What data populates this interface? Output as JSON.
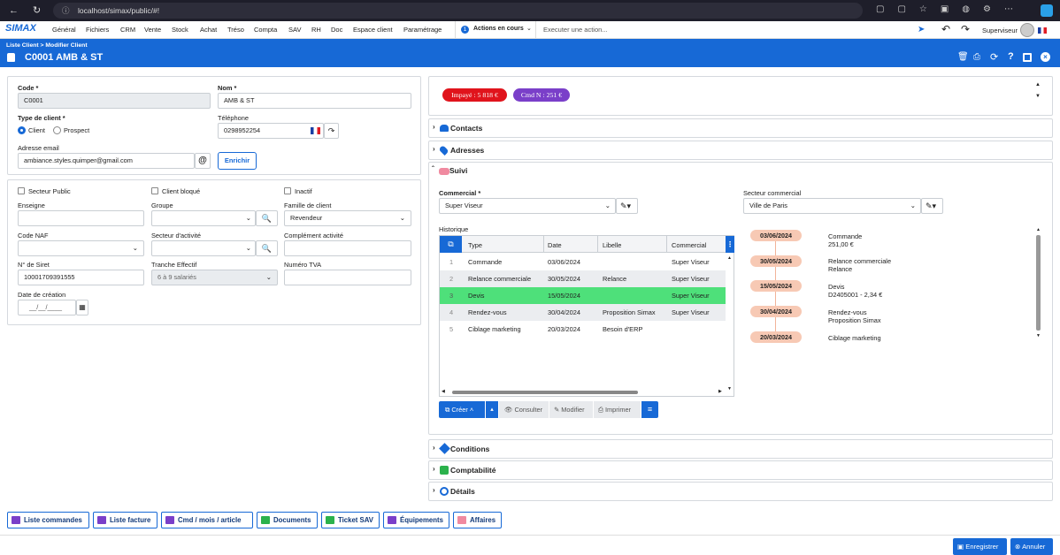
{
  "browser": {
    "url": "localhost/simax/public/#!"
  },
  "menu": {
    "logo": "SIMAX",
    "items": [
      "Général",
      "Fichiers",
      "CRM",
      "Vente",
      "Stock",
      "Achat",
      "Tréso",
      "Compta",
      "SAV",
      "RH",
      "Doc",
      "Espace client",
      "Paramétrage"
    ],
    "actions_count": "1",
    "actions_label": "Actions en cours",
    "execute_placeholder": "Executer une action...",
    "user": "Superviseur"
  },
  "header": {
    "breadcrumb": "Liste Client > Modifier Client",
    "title": "C0001 AMB & ST"
  },
  "form": {
    "code_label": "Code *",
    "code_value": "C0001",
    "nom_label": "Nom *",
    "nom_value": "AMB & ST",
    "type_label": "Type de client *",
    "type_client": "Client",
    "type_prospect": "Prospect",
    "tel_label": "Téléphone",
    "tel_value": "0298952254",
    "email_label": "Adresse email",
    "email_value": "ambiance.styles.quimper@gmail.com",
    "enrichir": "Enrichir",
    "secteur_public": "Secteur Public",
    "client_bloque": "Client bloqué",
    "inactif": "Inactif",
    "enseigne_label": "Enseigne",
    "groupe_label": "Groupe",
    "famille_label": "Famille de client",
    "famille_value": "Revendeur",
    "naf_label": "Code NAF",
    "secteur_label": "Secteur d'activité",
    "complement_label": "Complément activité",
    "siret_label": "N° de Siret",
    "siret_value": "10001709391555",
    "tranche_label": "Tranche Effectif",
    "tranche_value": "6 à 9 salariés",
    "tva_label": "Numéro TVA",
    "creation_label": "Date de création",
    "creation_value": "__/__/____"
  },
  "badges": {
    "impaye": "Impayé : 5 818 €",
    "cmd": "Cmd N : 251 €"
  },
  "sections": {
    "contacts": "Contacts",
    "adresses": "Adresses",
    "suivi": "Suivi",
    "conditions": "Conditions",
    "comptabilite": "Comptabilité",
    "details": "Détails"
  },
  "suivi": {
    "commercial_label": "Commercial *",
    "commercial_value": "Super Viseur",
    "secteur_label": "Secteur commercial",
    "secteur_value": "Ville de Paris",
    "historique_label": "Historique",
    "columns": [
      "Type",
      "Date",
      "Libelle",
      "Commercial"
    ],
    "rows": [
      {
        "n": "1",
        "type": "Commande",
        "date": "03/06/2024",
        "libelle": "",
        "commercial": "Super Viseur"
      },
      {
        "n": "2",
        "type": "Relance commerciale",
        "date": "30/05/2024",
        "libelle": "Relance",
        "commercial": "Super Viseur"
      },
      {
        "n": "3",
        "type": "Devis",
        "date": "15/05/2024",
        "libelle": "",
        "commercial": "Super Viseur"
      },
      {
        "n": "4",
        "type": "Rendez-vous",
        "date": "30/04/2024",
        "libelle": "Proposition Simax",
        "commercial": "Super Viseur"
      },
      {
        "n": "5",
        "type": "Ciblage marketing",
        "date": "20/03/2024",
        "libelle": "Besoin d'ERP",
        "commercial": ""
      }
    ],
    "buttons": {
      "creer": "Créer",
      "consulter": "Consulter",
      "modifier": "Modifier",
      "imprimer": "Imprimer"
    },
    "timeline": [
      {
        "date": "03/06/2024",
        "l1": "Commande",
        "l2": "251,00 €"
      },
      {
        "date": "30/05/2024",
        "l1": "Relance commerciale",
        "l2": "Relance"
      },
      {
        "date": "15/05/2024",
        "l1": "Devis",
        "l2": "D2405001 - 2,34 €"
      },
      {
        "date": "30/04/2024",
        "l1": "Rendez-vous",
        "l2": "Proposition Simax"
      },
      {
        "date": "20/03/2024",
        "l1": "Ciblage marketing",
        "l2": ""
      }
    ]
  },
  "bottom_buttons": [
    "Liste commandes",
    "Liste facture",
    "Cmd / mois / article",
    "Documents",
    "Ticket SAV",
    "Équipements",
    "Affaires"
  ],
  "footer": {
    "enregistrer": "Enregistrer",
    "annuler": "Annuler"
  },
  "colors": {
    "primary": "#1769d6",
    "impaye": "#e0141c",
    "cmd": "#7a3fc9",
    "selected_row": "#4ee07a",
    "timeline_date": "#f7c9b4"
  }
}
